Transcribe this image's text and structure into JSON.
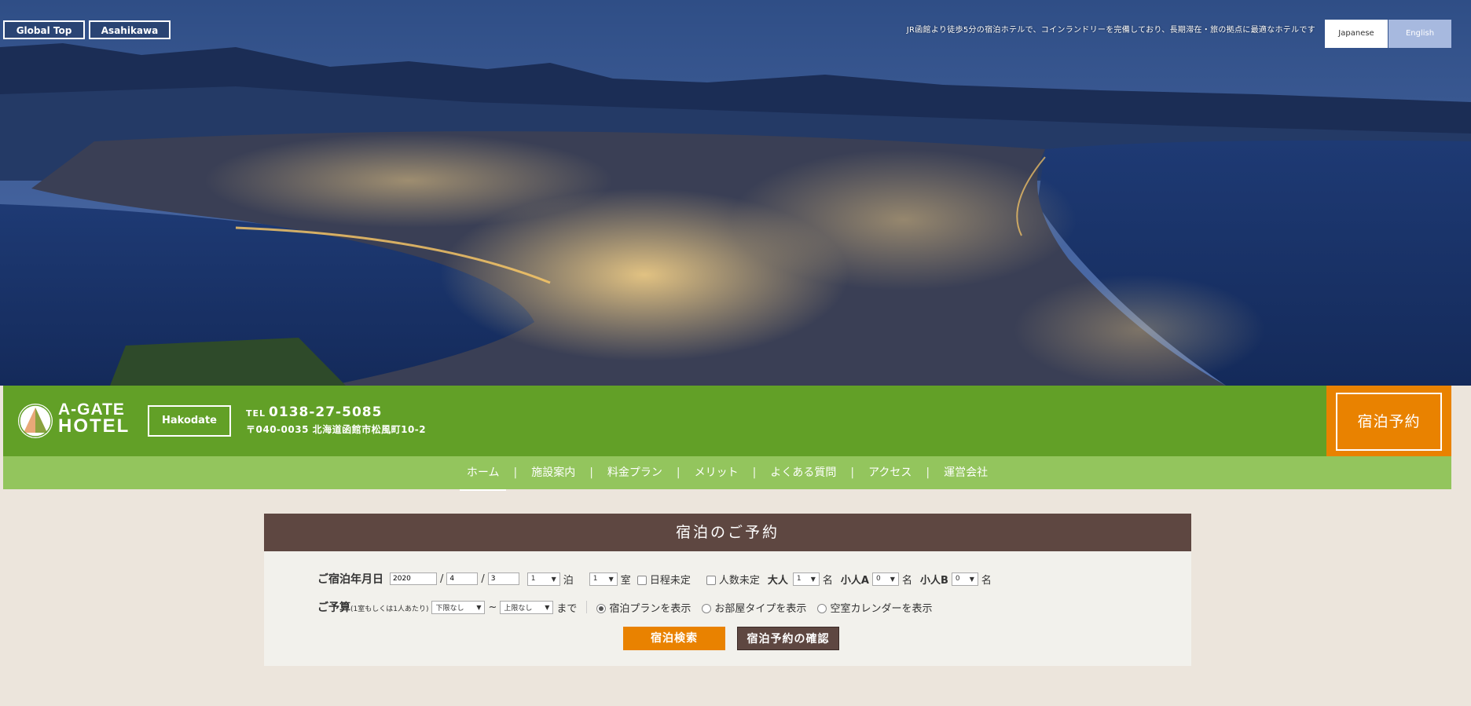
{
  "hero": {
    "global_top": "Global Top",
    "asahikawa": "Asahikawa",
    "tagline": "JR函館より徒歩5分の宿泊ホテルで、コインランドリーを完備しており、長期滞在・旅の拠点に最適なホテルです",
    "lang_ja": "Japanese",
    "lang_en": "English"
  },
  "brand": {
    "logo_line1": "A-GATE",
    "logo_line2": "HOTEL",
    "city": "Hakodate",
    "tel_label": "TEL",
    "tel": "0138-27-5085",
    "address": "〒040-0035 北海道函館市松風町10-2",
    "reserve": "宿泊予約",
    "colors": {
      "green": "#62a027",
      "light_green": "#93c55d",
      "orange": "#e98200",
      "brown": "#5e4741"
    }
  },
  "nav": {
    "items": [
      "ホーム",
      "施設案内",
      "料金プラン",
      "メリット",
      "よくある質問",
      "アクセス",
      "運営会社"
    ],
    "separator": "|"
  },
  "booking": {
    "title": "宿泊のご予約",
    "date_label": "ご宿泊年月日",
    "year": "2020",
    "month": "4",
    "day": "3",
    "slash": "/",
    "nights_value": "1",
    "nights_unit": "泊",
    "rooms_value": "1",
    "rooms_unit": "室",
    "undecided_dates": "日程未定",
    "undecided_people": "人数未定",
    "adult_label": "大人",
    "adult_value": "1",
    "child_a_label": "小人A",
    "child_a_value": "0",
    "child_b_label": "小人B",
    "child_b_value": "0",
    "person_unit": "名",
    "budget_label": "ご予算",
    "budget_note": "(1室もしくは1人あたり)",
    "budget_min": "下限なし",
    "dash": "~",
    "budget_max": "上限なし",
    "until": "まで",
    "radio_plan": "宿泊プランを表示",
    "radio_room": "お部屋タイプを表示",
    "radio_calendar": "空室カレンダーを表示",
    "search_button": "宿泊検索",
    "confirm_button": "宿泊予約の確認"
  }
}
